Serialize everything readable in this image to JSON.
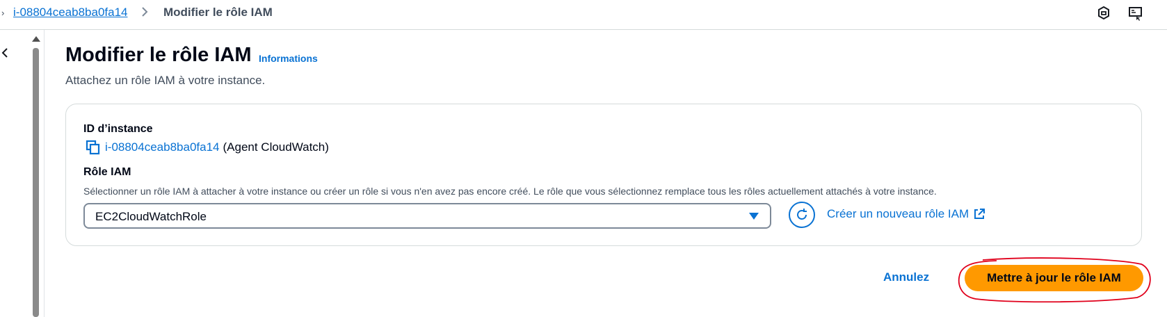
{
  "breadcrumb": {
    "instance_link": "i-08804ceab8ba0fa14",
    "current": "Modifier le rôle IAM"
  },
  "header": {
    "title": "Modifier le rôle IAM",
    "info_link": "Informations",
    "subtitle": "Attachez un rôle IAM à votre instance."
  },
  "form": {
    "instance_label": "ID d’instance",
    "instance_id": "i-08804ceab8ba0fa14",
    "instance_name": "(Agent CloudWatch)",
    "role_label": "Rôle IAM",
    "role_description": "Sélectionner un rôle IAM à attacher à votre instance ou créer un rôle si vous n'en avez pas encore créé. Le rôle que vous sélectionnez remplace tous les rôles actuellement attachés à votre instance.",
    "role_selected": "EC2CloudWatchRole",
    "create_role_link": "Créer un nouveau rôle IAM"
  },
  "actions": {
    "cancel": "Annulez",
    "submit": "Mettre à jour le rôle IAM"
  },
  "icons": {
    "top_right_1": "notifications-settings-icon",
    "top_right_2": "screen-share-icon",
    "copy": "copy-icon",
    "refresh": "refresh-icon",
    "external": "external-link-icon"
  },
  "colors": {
    "link": "#0972d3",
    "primary": "#ff9900",
    "annotation": "#e0001b"
  }
}
